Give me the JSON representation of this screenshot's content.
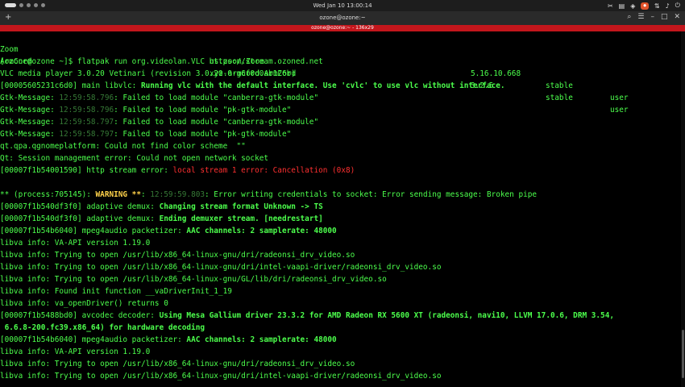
{
  "topbar": {
    "clock": "Wed Jan 10  13:00:14",
    "recording_badge": "⏺",
    "tray_icons": [
      "screenshot-icon",
      "clipboard-icon",
      "network-icon",
      "volume-icon",
      "battery-icon",
      "power-icon"
    ]
  },
  "window": {
    "title": "ozone@ozone:~",
    "subtitle": "ozone@ozone:~ - 136x29"
  },
  "terminal": {
    "apps": [
      {
        "name": "Zoom",
        "id": "us.zoom.Zoom",
        "version": "5.16.10.668",
        "branch": "stable",
        "install": "user"
      },
      {
        "name": "ArmCord",
        "id": "xyz.armcord.ArmCord",
        "version": "3.2.5",
        "branch": "stable",
        "install": "user"
      }
    ],
    "prompt": "[ozone@ozone ~]$ flatpak run org.videolan.VLC https://stream.ozoned.net",
    "vlc_version": "VLC media player 3.0.20 Vetinari (revision 3.0.20-0-g6f0d0ab126b)",
    "main_prefix": "[00005605231c6d0] main libvlc: ",
    "main_msg": "Running vlc with the default interface. Use 'cvlc' to use vlc without interface.",
    "gtk": [
      {
        "prefix": "Gtk-Message: ",
        "time": "12:59:58.796",
        "msg": ": Failed to load module \"canberra-gtk-module\""
      },
      {
        "prefix": "Gtk-Message: ",
        "time": "12:59:58.796",
        "msg": ": Failed to load module \"pk-gtk-module\""
      },
      {
        "prefix": "Gtk-Message: ",
        "time": "12:59:58.797",
        "msg": ": Failed to load module \"canberra-gtk-module\""
      },
      {
        "prefix": "Gtk-Message: ",
        "time": "12:59:58.797",
        "msg": ": Failed to load module \"pk-gtk-module\""
      }
    ],
    "qt_color": "qt.qpa.qgnomeplatform: Could not find color scheme  \"\"",
    "qt_session": "Qt: Session management error: Could not open network socket",
    "http_prefix": "[00007f1b54001590] http stream error: ",
    "http_error": "local stream 1 error: Cancellation (0x8)",
    "warn_prefix": "** (process:705145): ",
    "warn_word": "WARNING **",
    "warn_sep": ": ",
    "warn_time": "12:59:59.803",
    "warn_msg": ": Error writing credentials to socket: Error sending message: Broken pipe",
    "demux1_prefix": "[00007f1b540df3f0] adaptive demux: ",
    "demux1_msg": "Changing stream format Unknown -> TS",
    "demux2_prefix": "[00007f1b540df3f0] adaptive demux: ",
    "demux2_msg": "Ending demuxer stream. [needrestart]",
    "mpeg1_prefix": "[00007f1b54b6040] mpeg4audio packetizer: ",
    "mpeg1_msg": "AAC channels: 2 samplerate: 48000",
    "libva": [
      "libva info: VA-API version 1.19.0",
      "libva info: Trying to open /usr/lib/x86_64-linux-gnu/dri/radeonsi_drv_video.so",
      "libva info: Trying to open /usr/lib/x86_64-linux-gnu/dri/intel-vaapi-driver/radeonsi_drv_video.so",
      "libva info: Trying to open /usr/lib/x86_64-linux-gnu/GL/lib/dri/radeonsi_drv_video.so",
      "libva info: Found init function __vaDriverInit_1_19",
      "libva info: va_openDriver() returns 0"
    ],
    "avcodec_prefix": "[00007f1b5488bd0] avcodec decoder: ",
    "avcodec_msg": "Using Mesa Gallium driver 23.3.2 for AMD Radeon RX 5600 XT (radeonsi, navi10, LLVM 17.0.6, DRM 3.54,",
    "avcodec_cont": " 6.6.8-200.fc39.x86_64) for hardware decoding",
    "mpeg2_prefix": "[00007f1b54b6040] mpeg4audio packetizer: ",
    "mpeg2_msg": "AAC channels: 2 samplerate: 48000",
    "libva2": [
      "libva info: VA-API version 1.19.0",
      "libva info: Trying to open /usr/lib/x86_64-linux-gnu/dri/radeonsi_drv_video.so",
      "libva info: Trying to open /usr/lib/x86_64-linux-gnu/dri/intel-vaapi-driver/radeonsi_drv_video.so"
    ]
  },
  "colors": {
    "green": "#4cff4c",
    "red": "#ff3030",
    "warning": "#ffd24a",
    "titlebar_accent": "#c3161c"
  }
}
